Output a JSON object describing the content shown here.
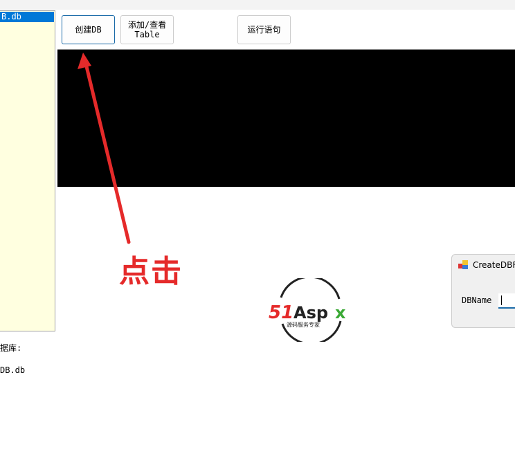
{
  "file_list": {
    "items": [
      "B.db"
    ]
  },
  "toolbar": {
    "create_db": "创建DB",
    "add_view_table_line1": "添加/查看",
    "add_view_table_line2": "Table",
    "run_statement": "运行语句"
  },
  "db_label": "据库:",
  "db_value": "DB.db",
  "annotation": {
    "text": "点击",
    "color": "#e52a2a"
  },
  "logo": {
    "text": "51Aspx",
    "subtitle": "源码服务专家"
  },
  "dialog": {
    "title": "CreateDBFo",
    "field_label": "DBName",
    "field_value": ""
  }
}
